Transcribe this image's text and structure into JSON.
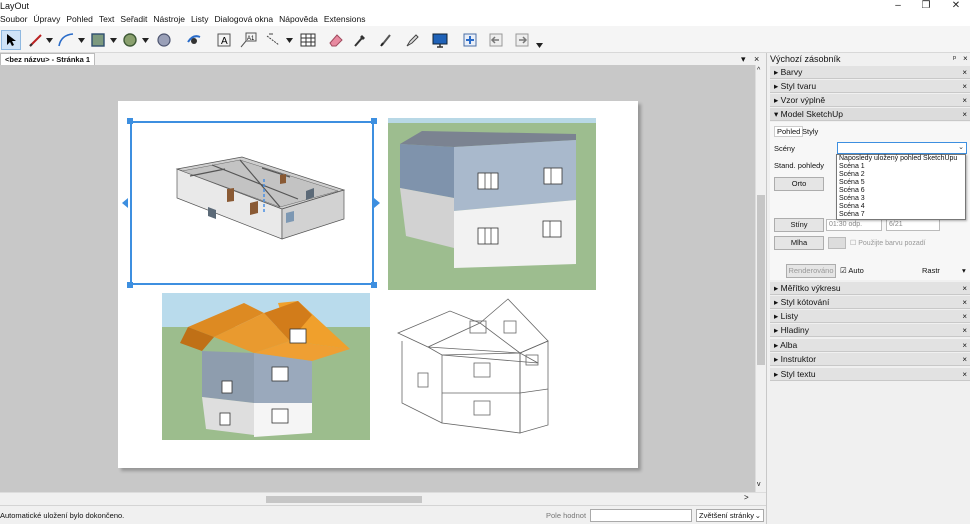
{
  "window": {
    "title": "LayOut"
  },
  "menu": [
    "Soubor",
    "Úpravy",
    "Pohled",
    "Text",
    "Seřadit",
    "Nástroje",
    "Listy",
    "Dialogová okna",
    "Nápověda",
    "Extensions"
  ],
  "toolbar": {
    "tools": [
      "select-arrow-icon",
      "pencil-line-icon",
      "arc-icon",
      "rectangle-icon",
      "circle-icon",
      "polygon-icon",
      "offset-icon",
      "text-icon",
      "label-icon",
      "dimension-icon",
      "table-icon",
      "eraser-icon",
      "eyedropper-icon",
      "split-icon",
      "join-icon",
      "presentation-icon",
      "add-page-icon",
      "previous-page-icon",
      "next-page-icon"
    ]
  },
  "document": {
    "tab_label": "<bez názvu> - Stránka 1"
  },
  "status": {
    "message": "Automatické uložení bylo dokončeno.",
    "measure_label": "Pole hodnot",
    "zoom_label": "Zvětšení stránky"
  },
  "panel": {
    "title": "Výchozí zásobník",
    "trays_top": [
      "Barvy",
      "Styl tvaru",
      "Vzor výplně",
      "Model SketchUp"
    ],
    "trays_bottom": [
      "Měřítko výkresu",
      "Styl kótování",
      "Listy",
      "Hladiny",
      "Alba",
      "Instruktor",
      "Styl textu"
    ],
    "sketchup": {
      "tab_view": "Pohled",
      "tab_styles": "Styly",
      "scenes_label": "Scény",
      "std_views_label": "Stand. pohledy",
      "ortho_button": "Orto",
      "shadows_button": "Stíny",
      "fog_button": "Mlha",
      "time_value": "01:30 odp.",
      "date_value": "6/21",
      "fog_color_label": "Použijte barvu pozadí",
      "render_button": "Renderováno",
      "auto_label": "Auto",
      "render_mode": "Rastr",
      "scenes_options": [
        "Naposledy uložený pohled SketchUpu",
        "Scéna 1",
        "Scéna 2",
        "Scéna 5",
        "Scéna 6",
        "Scéna 3",
        "Scéna 4",
        "Scéna 7"
      ]
    }
  }
}
